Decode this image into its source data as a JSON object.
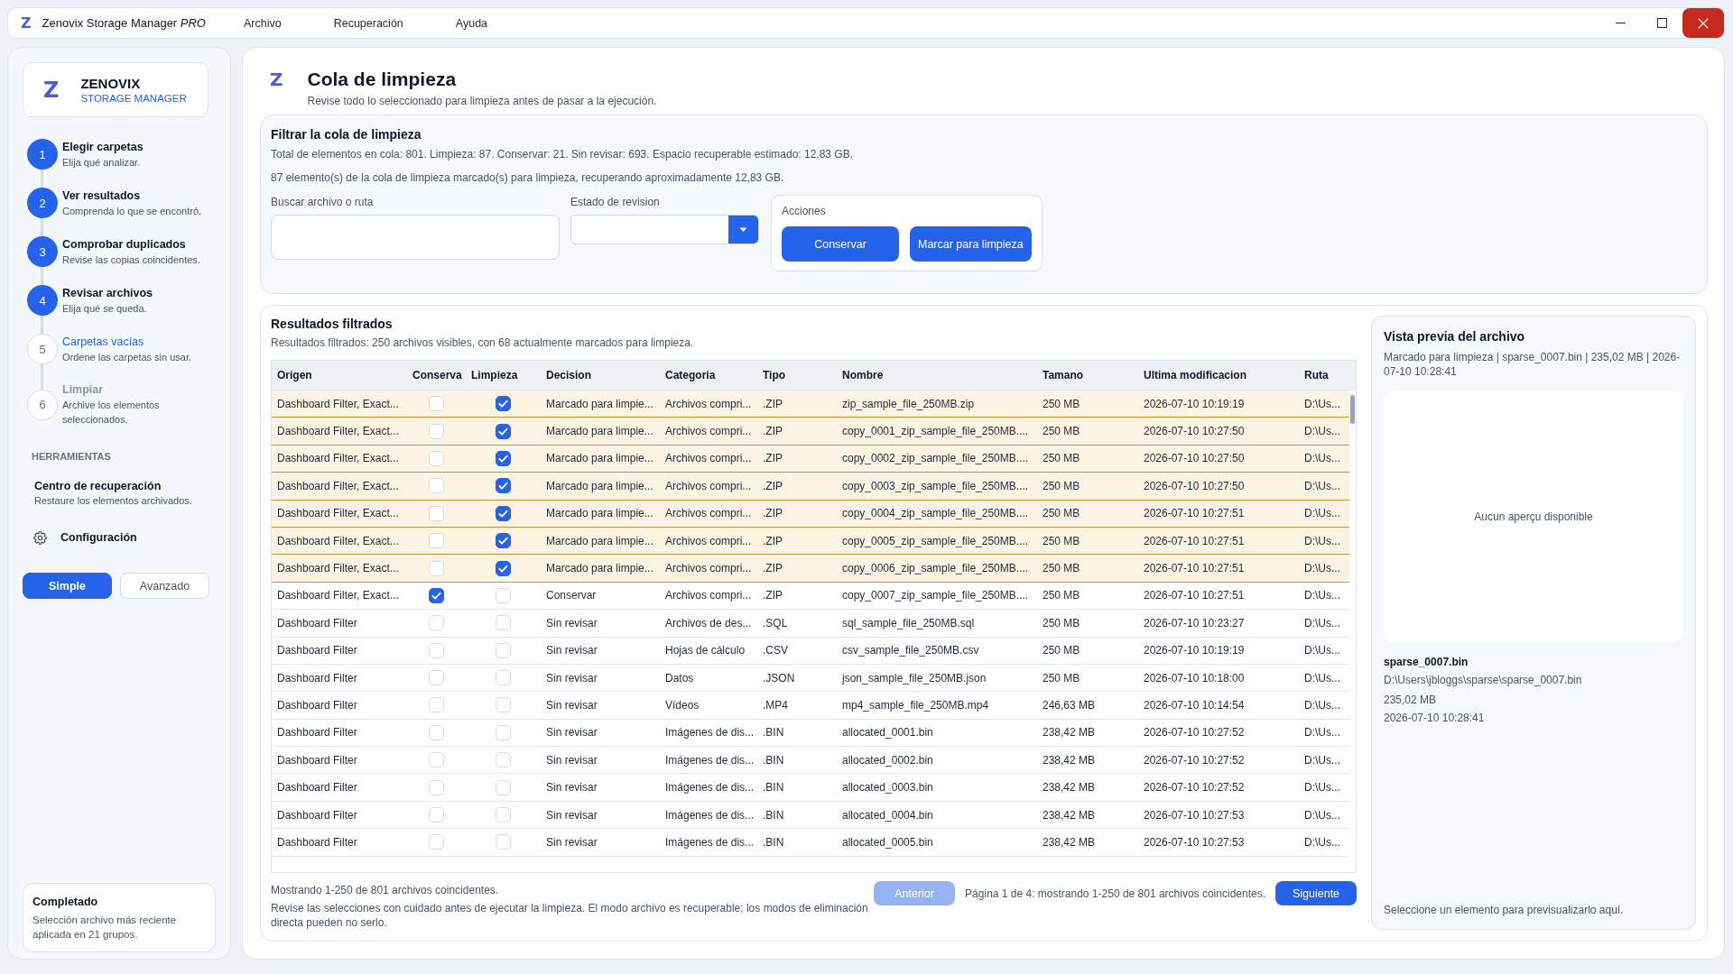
{
  "window": {
    "logo": "Z",
    "title": "Zenovix Storage Manager *PRO*",
    "menu": [
      "Archivo",
      "Recuperación",
      "Ayuda"
    ]
  },
  "sidebar": {
    "brand": {
      "logo": "Z",
      "name": "ZENOVIX",
      "subtitle": "STORAGE MANAGER"
    },
    "steps": [
      {
        "number": "1",
        "title": "Elegir carpetas",
        "subtitle": "Elija qué analizar.",
        "completed": true,
        "disabled": false
      },
      {
        "number": "2",
        "title": "Ver resultados",
        "subtitle": "Comprenda lo que se encontró.",
        "completed": true,
        "disabled": false
      },
      {
        "number": "3",
        "title": "Comprobar duplicados",
        "subtitle": "Revise las copias coincidentes.",
        "completed": true,
        "disabled": false
      },
      {
        "number": "4",
        "title": "Revisar archivos",
        "subtitle": "Elija qué se queda.",
        "completed": true,
        "disabled": false
      },
      {
        "number": "5",
        "title": "Carpetas vacías",
        "subtitle": "Ordene las carpetas sin usar.",
        "completed": false,
        "disabled": false
      },
      {
        "number": "6",
        "title": "Limpiar",
        "subtitle": "Archive los elementos seleccionados.",
        "completed": false,
        "disabled": true
      }
    ],
    "tools_heading": "HERRAMIENTAS",
    "tools": [
      {
        "kind": "link",
        "title": "Centro de recuperación",
        "subtitle": "Restaure los elementos archivados."
      },
      {
        "kind": "settings",
        "title": "Configuración"
      }
    ],
    "modes": [
      {
        "label": "Simple",
        "selected": true
      },
      {
        "label": "Avanzado",
        "selected": false
      }
    ],
    "status_card": {
      "title": "Completado",
      "text": "Selección archivo más reciente aplicada en 21 grupos."
    }
  },
  "page": {
    "logo": "Z",
    "title": "Cola de limpieza",
    "subtitle": "Revise todo lo seleccionado para limpieza antes de pasar a la ejecución."
  },
  "filter": {
    "title": "Filtrar la cola de limpieza",
    "summary": "Total de elementos en cola: 801. Limpieza: 87. Conservar: 21. Sin revisar: 693. Espacio recuperable estimado: 12,83 GB.",
    "selection_note": "87 elemento(s) de la cola de limpieza marcado(s) para limpieza, recuperando aproximadamente 12,83 GB.",
    "search": {
      "label": "Buscar archivo o ruta"
    },
    "review_status": {
      "label": "Estado de revision"
    },
    "actions": {
      "label": "Acciones",
      "buttons": [
        "Conservar",
        "Marcar para limpieza"
      ]
    }
  },
  "results": {
    "title": "Resultados filtrados",
    "subtitle": "Resultados filtrados: 250 archivos visibles, con 68 actualmente marcados para limpieza.",
    "table": {
      "columns": [
        {
          "label": "Origen",
          "kind": "text"
        },
        {
          "label": "Conserva",
          "kind": "keep"
        },
        {
          "label": "Limpieza",
          "kind": "clean"
        },
        {
          "label": "Decision",
          "kind": "text"
        },
        {
          "label": "Categoria",
          "kind": "text"
        },
        {
          "label": "Tipo",
          "kind": "text"
        },
        {
          "label": "Nombre",
          "kind": "text"
        },
        {
          "label": "Tamano",
          "kind": "text"
        },
        {
          "label": "Ultima modificacion",
          "kind": "text"
        },
        {
          "label": "Ruta",
          "kind": "text"
        }
      ],
      "rows": [
        {
          "cells": [
            "Dashboard Filter, Exact...",
            {
              "checked": false
            },
            {
              "checked": true
            },
            "Marcado para limpie...",
            "Archivos compri...",
            ".ZIP",
            "zip_sample_file_250MB.zip",
            "250 MB",
            "2026-07-10 10:19:19",
            "D:\\Us..."
          ]
        },
        {
          "cells": [
            "Dashboard Filter, Exact...",
            {
              "checked": false
            },
            {
              "checked": true
            },
            "Marcado para limpie...",
            "Archivos compri...",
            ".ZIP",
            "copy_0001_zip_sample_file_250MB....",
            "250 MB",
            "2026-07-10 10:27:50",
            "D:\\Us..."
          ]
        },
        {
          "cells": [
            "Dashboard Filter, Exact...",
            {
              "checked": false
            },
            {
              "checked": true
            },
            "Marcado para limpie...",
            "Archivos compri...",
            ".ZIP",
            "copy_0002_zip_sample_file_250MB....",
            "250 MB",
            "2026-07-10 10:27:50",
            "D:\\Us..."
          ]
        },
        {
          "cells": [
            "Dashboard Filter, Exact...",
            {
              "checked": false
            },
            {
              "checked": true
            },
            "Marcado para limpie...",
            "Archivos compri...",
            ".ZIP",
            "copy_0003_zip_sample_file_250MB....",
            "250 MB",
            "2026-07-10 10:27:50",
            "D:\\Us..."
          ]
        },
        {
          "cells": [
            "Dashboard Filter, Exact...",
            {
              "checked": false
            },
            {
              "checked": true
            },
            "Marcado para limpie...",
            "Archivos compri...",
            ".ZIP",
            "copy_0004_zip_sample_file_250MB....",
            "250 MB",
            "2026-07-10 10:27:51",
            "D:\\Us..."
          ]
        },
        {
          "cells": [
            "Dashboard Filter, Exact...",
            {
              "checked": false
            },
            {
              "checked": true
            },
            "Marcado para limpie...",
            "Archivos compri...",
            ".ZIP",
            "copy_0005_zip_sample_file_250MB....",
            "250 MB",
            "2026-07-10 10:27:51",
            "D:\\Us..."
          ]
        },
        {
          "cells": [
            "Dashboard Filter, Exact...",
            {
              "checked": false
            },
            {
              "checked": true
            },
            "Marcado para limpie...",
            "Archivos compri...",
            ".ZIP",
            "copy_0006_zip_sample_file_250MB....",
            "250 MB",
            "2026-07-10 10:27:51",
            "D:\\Us..."
          ]
        },
        {
          "cells": [
            "Dashboard Filter, Exact...",
            {
              "checked": true
            },
            {
              "checked": false
            },
            "Conservar",
            "Archivos compri...",
            ".ZIP",
            "copy_0007_zip_sample_file_250MB....",
            "250 MB",
            "2026-07-10 10:27:51",
            "D:\\Us..."
          ]
        },
        {
          "cells": [
            "Dashboard Filter",
            {
              "checked": false
            },
            {
              "checked": false
            },
            "Sin revisar",
            "Archivos de des...",
            ".SQL",
            "sql_sample_file_250MB.sql",
            "250 MB",
            "2026-07-10 10:23:27",
            "D:\\Us..."
          ]
        },
        {
          "cells": [
            "Dashboard Filter",
            {
              "checked": false
            },
            {
              "checked": false
            },
            "Sin revisar",
            "Hojas de cálculo",
            ".CSV",
            "csv_sample_file_250MB.csv",
            "250 MB",
            "2026-07-10 10:19:19",
            "D:\\Us..."
          ]
        },
        {
          "cells": [
            "Dashboard Filter",
            {
              "checked": false
            },
            {
              "checked": false
            },
            "Sin revisar",
            "Datos",
            ".JSON",
            "json_sample_file_250MB.json",
            "250 MB",
            "2026-07-10 10:18:00",
            "D:\\Us..."
          ]
        },
        {
          "cells": [
            "Dashboard Filter",
            {
              "checked": false
            },
            {
              "checked": false
            },
            "Sin revisar",
            "Vídeos",
            ".MP4",
            "mp4_sample_file_250MB.mp4",
            "246,63 MB",
            "2026-07-10 10:14:54",
            "D:\\Us..."
          ]
        },
        {
          "cells": [
            "Dashboard Filter",
            {
              "checked": false
            },
            {
              "checked": false
            },
            "Sin revisar",
            "Imágenes de dis...",
            ".BIN",
            "allocated_0001.bin",
            "238,42 MB",
            "2026-07-10 10:27:52",
            "D:\\Us..."
          ]
        },
        {
          "cells": [
            "Dashboard Filter",
            {
              "checked": false
            },
            {
              "checked": false
            },
            "Sin revisar",
            "Imágenes de dis...",
            ".BIN",
            "allocated_0002.bin",
            "238,42 MB",
            "2026-07-10 10:27:52",
            "D:\\Us..."
          ]
        },
        {
          "cells": [
            "Dashboard Filter",
            {
              "checked": false
            },
            {
              "checked": false
            },
            "Sin revisar",
            "Imágenes de dis...",
            ".BIN",
            "allocated_0003.bin",
            "238,42 MB",
            "2026-07-10 10:27:52",
            "D:\\Us..."
          ]
        },
        {
          "cells": [
            "Dashboard Filter",
            {
              "checked": false
            },
            {
              "checked": false
            },
            "Sin revisar",
            "Imágenes de dis...",
            ".BIN",
            "allocated_0004.bin",
            "238,42 MB",
            "2026-07-10 10:27:53",
            "D:\\Us..."
          ]
        },
        {
          "cells": [
            "Dashboard Filter",
            {
              "checked": false
            },
            {
              "checked": false
            },
            "Sin revisar",
            "Imágenes de dis...",
            ".BIN",
            "allocated_0005.bin",
            "238,42 MB",
            "2026-07-10 10:27:53",
            "D:\\Us..."
          ]
        }
      ]
    },
    "footer": {
      "count": "Mostrando 1-250 de 801 archivos coincidentes.",
      "warning": "Revise las selecciones con cuidado antes de ejecutar la limpieza. El modo archivo es recuperable; los modos de eliminación directa pueden no serlo.",
      "previous": {
        "label": "Anterior",
        "disabled": true
      },
      "page_info": "Página 1 de 4: mostrando 1-250 de 801 archivos coincidentes.",
      "next": {
        "label": "Siguiente",
        "disabled": false
      }
    }
  },
  "preview": {
    "title": "Vista previa del archivo",
    "meta": "Marcado para limpieza | sparse_0007.bin | 235,02 MB | 2026-07-10 10:28:41",
    "empty_message": "Aucun aperçu disponible",
    "file_name": "sparse_0007.bin",
    "path": "D:\\Users\\jbloggs\\sparse\\sparse_0007.bin",
    "size": "235,02 MB",
    "modified": "2026-07-10 10:28:41",
    "hint": "Seleccione un elemento para previsualizarlo aquí."
  }
}
